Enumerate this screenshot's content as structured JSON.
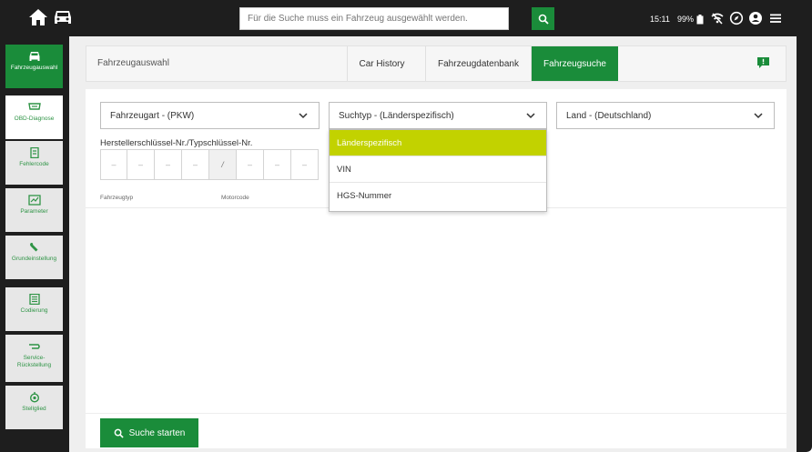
{
  "topbar": {
    "search_placeholder": "Für die Suche muss ein Fahrzeug ausgewählt werden.",
    "time": "15:11",
    "battery": "99%",
    "icons": [
      "home-icon",
      "car-icon",
      "search-icon",
      "wifi-off-icon",
      "compass-icon",
      "user-icon",
      "menu-icon"
    ]
  },
  "sidebar": {
    "items": [
      {
        "label": "Fahrzeugauswahl",
        "icon": "car-icon",
        "state": "active"
      },
      {
        "label": "OBD-Diagnose",
        "icon": "obd-icon",
        "state": "current"
      },
      {
        "label": "Fehlercode",
        "icon": "error-code-icon",
        "state": "normal"
      },
      {
        "label": "Parameter",
        "icon": "parameter-icon",
        "state": "normal"
      },
      {
        "label": "Grundeinstellung",
        "icon": "wrench-icon",
        "state": "normal"
      },
      {
        "label": "Codierung",
        "icon": "coding-icon",
        "state": "normal"
      },
      {
        "label": "Service-Rückstellung",
        "icon": "service-reset-icon",
        "state": "normal"
      },
      {
        "label": "Stellglied",
        "icon": "actuator-icon",
        "state": "normal"
      }
    ]
  },
  "header": {
    "title": "Fahrzeugauswahl",
    "tabs": [
      {
        "label": "Car History",
        "active": false
      },
      {
        "label": "Fahrzeugdatenbank",
        "active": false
      },
      {
        "label": "Fahrzeugsuche",
        "active": true
      }
    ]
  },
  "form": {
    "vehicle_type": "Fahrzeugart - (PKW)",
    "search_type": "Suchtyp - (Länderspezifisch)",
    "country": "Land - (Deutschland)",
    "hsn_label": "Herstellerschlüssel-Nr./Typschlüssel-Nr.",
    "cell_placeholder": "–",
    "separator": "/",
    "col_vehicle_type": "Fahrzeugtyp",
    "col_engine_code": "Motorcode"
  },
  "dropdown": {
    "options": [
      {
        "label": "Länderspezifisch",
        "selected": true
      },
      {
        "label": "VIN",
        "selected": false
      },
      {
        "label": "HGS-Nummer",
        "selected": false
      }
    ]
  },
  "actions": {
    "search_start": "Suche starten"
  },
  "colors": {
    "brand_green": "#1a8c3a",
    "selected_option": "#c2d200",
    "frame_dark": "#1e1e1e"
  }
}
